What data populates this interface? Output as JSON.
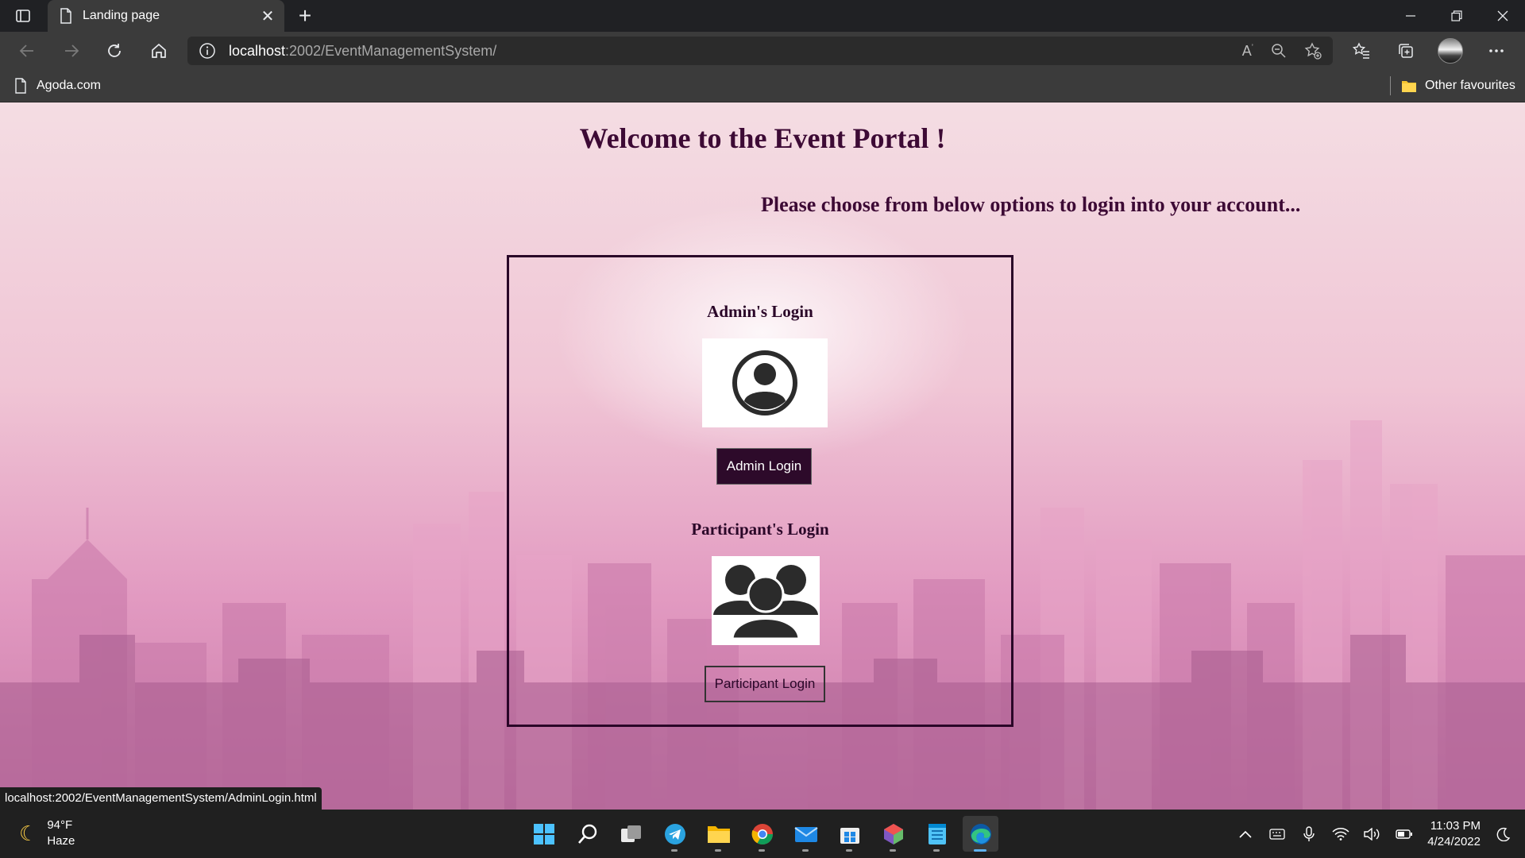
{
  "browser": {
    "tab_title": "Landing page",
    "url_host": "localhost",
    "url_path": ":2002/EventManagementSystem/",
    "favorites": [
      {
        "label": "Agoda.com"
      }
    ],
    "other_favourites": "Other favourites"
  },
  "page": {
    "heading": "Welcome to the Event Portal !",
    "subtitle": "Please choose from below options to login into your account...",
    "admin": {
      "title": "Admin's Login",
      "button": "Admin Login"
    },
    "participant": {
      "title": "Participant's Login",
      "button": "Participant Login"
    },
    "status_url": "localhost:2002/EventManagementSystem/AdminLogin.html"
  },
  "taskbar": {
    "weather_temp": "94°F",
    "weather_desc": "Haze",
    "time": "11:03 PM",
    "date": "4/24/2022",
    "apps": [
      "start-icon",
      "search-icon",
      "task-view-icon",
      "telegram-icon",
      "file-explorer-icon",
      "chrome-icon",
      "mail-icon",
      "store-icon",
      "app-icon",
      "notepad-icon",
      "edge-icon"
    ]
  },
  "colors": {
    "heading": "#3d0a35",
    "admin_button_bg": "#2d0a2a",
    "taskbar_bg": "#202020"
  }
}
